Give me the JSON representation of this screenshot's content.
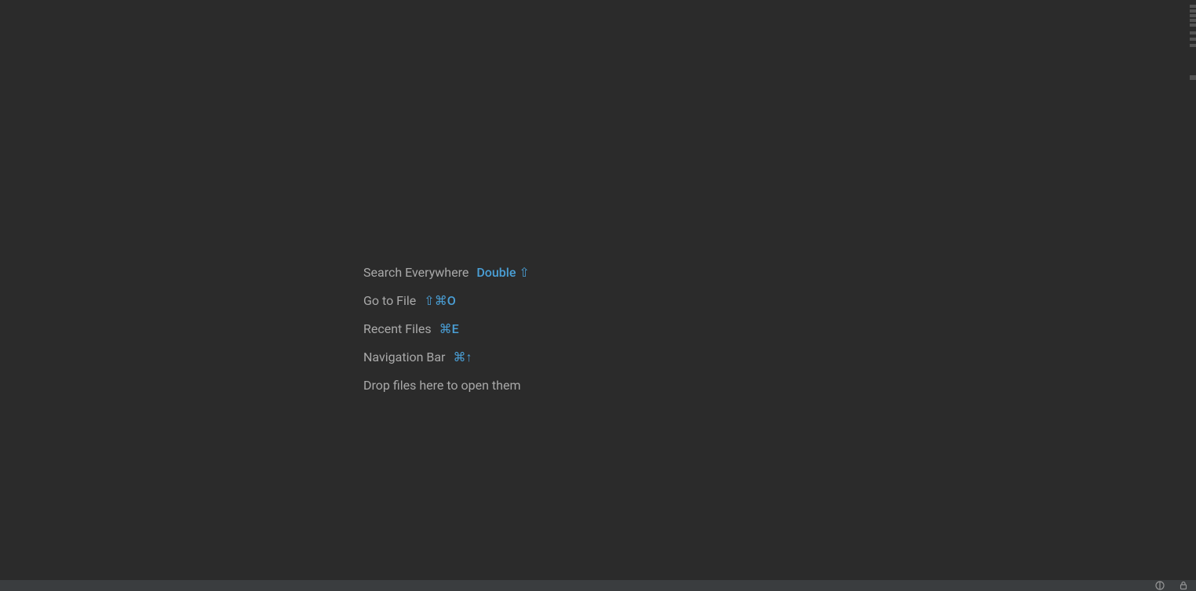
{
  "hints": {
    "search_everywhere": {
      "label": "Search Everywhere",
      "shortcut": "Double ⇧"
    },
    "go_to_file": {
      "label": "Go to File",
      "shortcut": "⇧⌘O"
    },
    "recent_files": {
      "label": "Recent Files",
      "shortcut": "⌘E"
    },
    "navigation_bar": {
      "label": "Navigation Bar",
      "shortcut": "⌘↑"
    },
    "drop_files": {
      "label": "Drop files here to open them"
    }
  },
  "colors": {
    "background": "#2b2b2b",
    "text": "#a9a9a9",
    "accent": "#4a9fd6",
    "status_bar": "#3a3d3f"
  },
  "status_icons": [
    "inspection-indicator-icon",
    "lock-icon"
  ]
}
